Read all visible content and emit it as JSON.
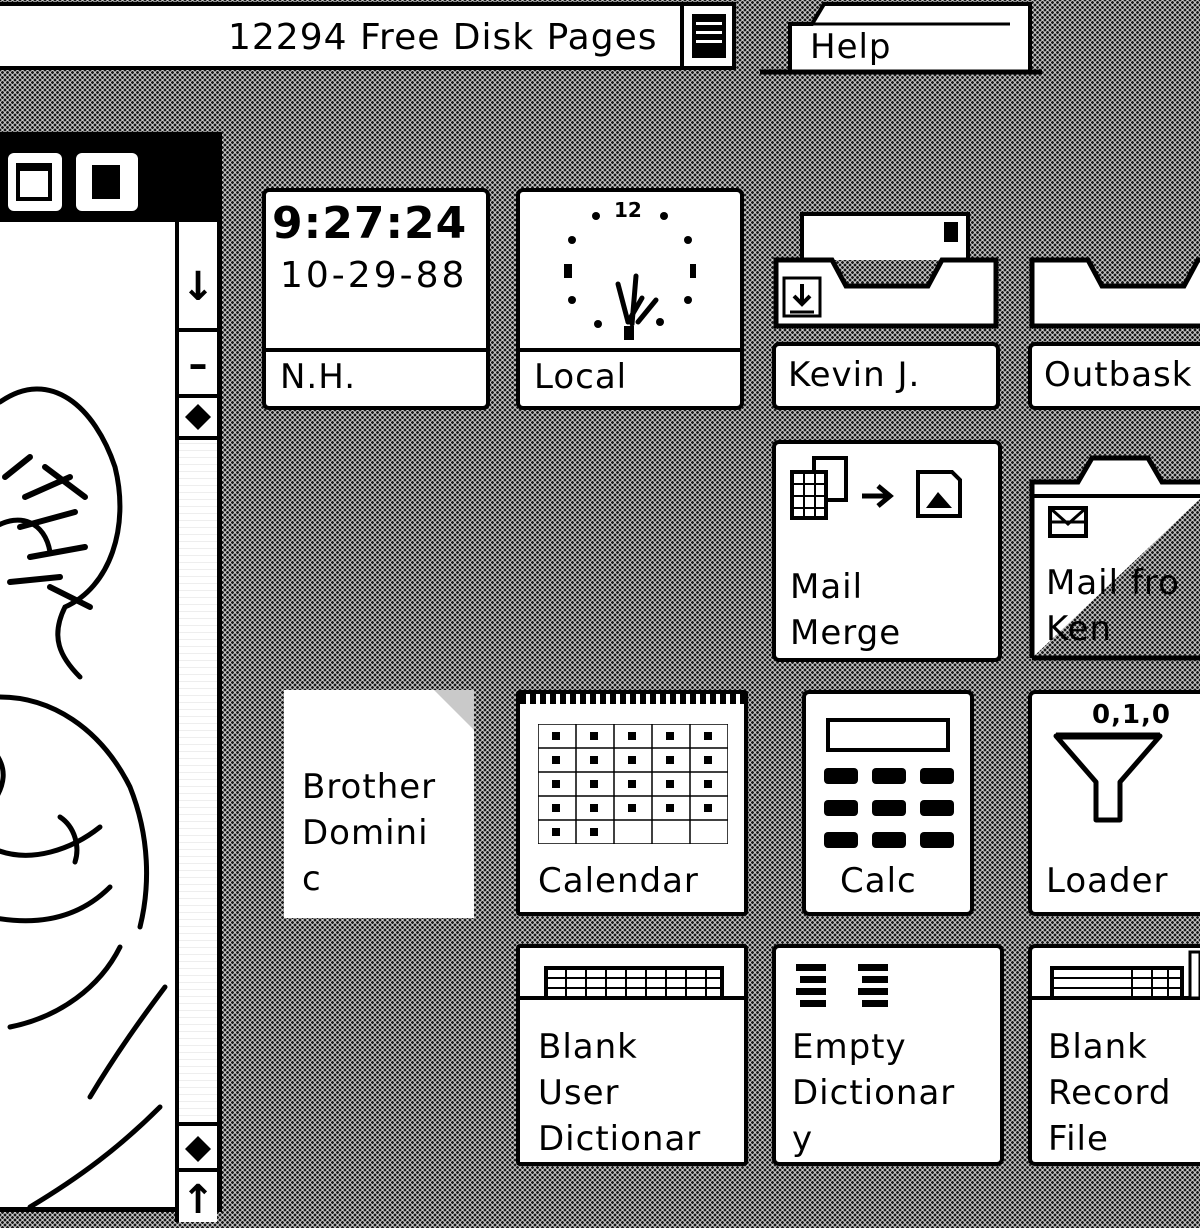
{
  "header": {
    "free_disk_pages": "12294 Free Disk Pages",
    "help_label": "Help"
  },
  "window": {
    "scroll_up_glyph": "↓",
    "scroll_minus_glyph": "–",
    "scroll_down_glyph": "↑"
  },
  "clock_digital": {
    "time": "9:27:24",
    "date": "10-29-88",
    "label": "N.H."
  },
  "clock_analog": {
    "twelve": "12",
    "label": "Local"
  },
  "inbasket": {
    "label": "Kevin J."
  },
  "outbasket": {
    "label": "Outbask"
  },
  "mail_merge": {
    "label": "Mail\nMerge"
  },
  "mail_from": {
    "label": "Mail fro\nKen"
  },
  "brother": {
    "label": "Brother\nDomini\nc"
  },
  "calendar": {
    "label": "Calendar"
  },
  "calc": {
    "label": "Calc"
  },
  "loader": {
    "badge": "0,1,0",
    "label": "Loader"
  },
  "blank_user_dictionary": {
    "label": "Blank\nUser\nDictionar"
  },
  "empty_dictionary": {
    "label": "Empty\nDictionar\ny"
  },
  "blank_record_file": {
    "label": "Blank\nRecord\nFile"
  },
  "colors": {
    "ink": "#000000",
    "paper": "#ffffff",
    "desktop": "#c9c9c9"
  }
}
